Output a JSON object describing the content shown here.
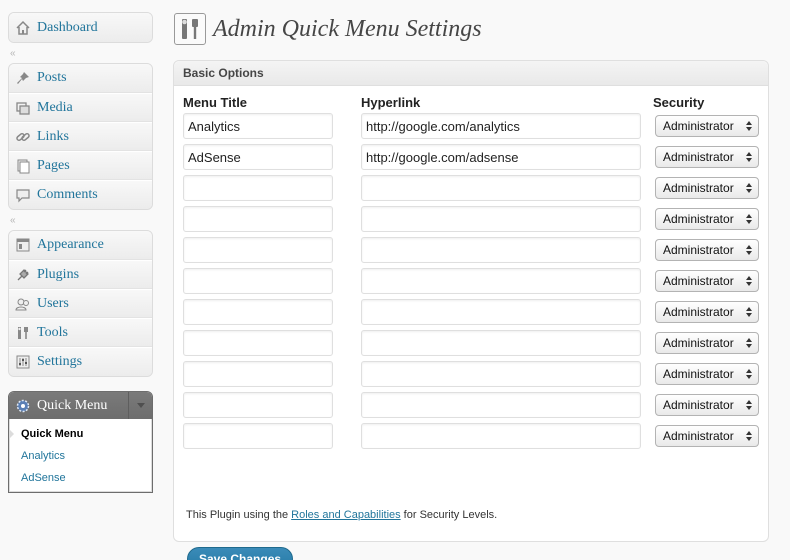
{
  "sidebar": {
    "dashboard": {
      "label": "Dashboard",
      "icon": "home-icon"
    },
    "separator_glyph": "«",
    "content_items": [
      {
        "label": "Posts",
        "icon": "pushpin-icon"
      },
      {
        "label": "Media",
        "icon": "media-icon"
      },
      {
        "label": "Links",
        "icon": "link-icon"
      },
      {
        "label": "Pages",
        "icon": "pages-icon"
      },
      {
        "label": "Comments",
        "icon": "comment-icon"
      }
    ],
    "admin_items": [
      {
        "label": "Appearance",
        "icon": "appearance-icon"
      },
      {
        "label": "Plugins",
        "icon": "plugin-icon"
      },
      {
        "label": "Users",
        "icon": "users-icon"
      },
      {
        "label": "Tools",
        "icon": "tools-icon"
      },
      {
        "label": "Settings",
        "icon": "settings-icon"
      }
    ],
    "quick_menu": {
      "label": "Quick Menu",
      "icon": "gear-icon",
      "submenu": [
        {
          "label": "Quick Menu",
          "current": true
        },
        {
          "label": "Analytics",
          "current": false
        },
        {
          "label": "AdSense",
          "current": false
        }
      ]
    }
  },
  "page": {
    "title": "Admin Quick Menu Settings",
    "icon": "tools-icon"
  },
  "box": {
    "title": "Basic Options",
    "columns": {
      "title": "Menu Title",
      "link": "Hyperlink",
      "security": "Security"
    },
    "rows": [
      {
        "title": "Analytics",
        "link": "http://google.com/analytics",
        "security": "Administrator"
      },
      {
        "title": "AdSense",
        "link": "http://google.com/adsense",
        "security": "Administrator"
      },
      {
        "title": "",
        "link": "",
        "security": "Administrator"
      },
      {
        "title": "",
        "link": "",
        "security": "Administrator"
      },
      {
        "title": "",
        "link": "",
        "security": "Administrator"
      },
      {
        "title": "",
        "link": "",
        "security": "Administrator"
      },
      {
        "title": "",
        "link": "",
        "security": "Administrator"
      },
      {
        "title": "",
        "link": "",
        "security": "Administrator"
      },
      {
        "title": "",
        "link": "",
        "security": "Administrator"
      },
      {
        "title": "",
        "link": "",
        "security": "Administrator"
      },
      {
        "title": "",
        "link": "",
        "security": "Administrator"
      }
    ],
    "note_prefix": "This Plugin using the ",
    "note_link": "Roles and Capabilities",
    "note_suffix": " for Security Levels.",
    "save_label": "Save Changes"
  },
  "colors": {
    "link": "#21759b",
    "button": "#247aa6",
    "quick_menu_header": "#6d6d6d"
  }
}
